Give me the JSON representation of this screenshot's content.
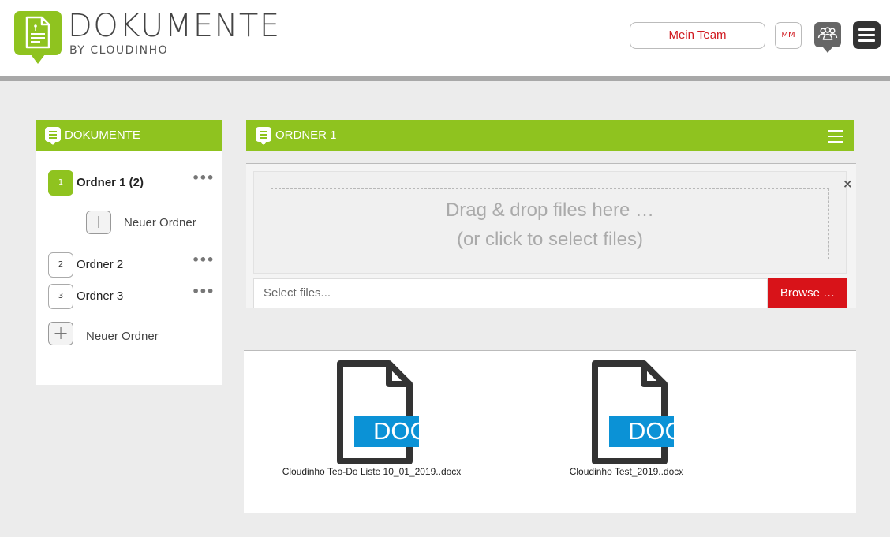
{
  "header": {
    "brand_title": "DOKUMENTE",
    "brand_sub": "BY CLOUDINHO",
    "team_button": "Mein Team",
    "avatar_initials": "MM",
    "accent_color": "#8fc31f",
    "alert_color": "#d81319"
  },
  "sidebar": {
    "title": "DOKUMENTE",
    "folders": [
      {
        "number": "1",
        "label": "Ordner 1 (2)",
        "active": true
      },
      {
        "number": "2",
        "label": "Ordner 2",
        "active": false
      },
      {
        "number": "3",
        "label": "Ordner 3",
        "active": false
      }
    ],
    "subfolder_new_label": "Neuer Ordner",
    "new_folder_label": "Neuer Ordner",
    "more_icon": "ellipsis-icon"
  },
  "main": {
    "title": "ORDNER 1",
    "dropzone_line1": "Drag & drop files here …",
    "dropzone_line2": "(or click to select files)",
    "close_symbol": "×",
    "file_input_placeholder": "Select files...",
    "browse_button": "Browse …",
    "files": [
      {
        "name": "Cloudinho Teo-Do Liste 10_01_2019..docx",
        "type_label": "DOCX"
      },
      {
        "name": "Cloudinho Test_2019..docx",
        "type_label": "DOCX"
      }
    ]
  }
}
